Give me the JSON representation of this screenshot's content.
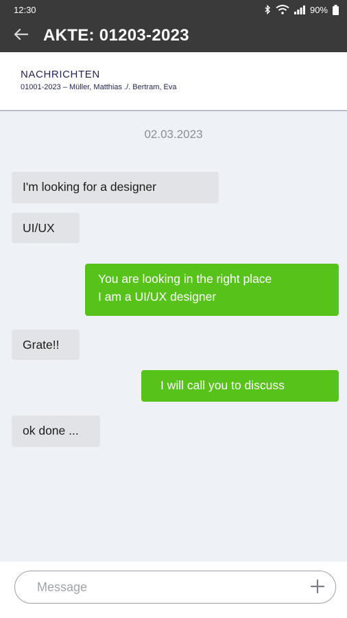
{
  "status_bar": {
    "time": "12:30",
    "battery": "90%",
    "icons": [
      "bluetooth-icon",
      "wifi-icon",
      "signal-icon",
      "battery-icon"
    ]
  },
  "app_bar": {
    "back_icon": "arrow-left-icon",
    "title": "AKTE: 01203-2023"
  },
  "header": {
    "section_title": "NACHRICHTEN",
    "case_subtitle": "01001-2023 – Müller, Matthias ./. Bertram, Eva"
  },
  "chat": {
    "date": "02.03.2023",
    "messages": [
      {
        "direction": "in",
        "lines": [
          "I'm looking for a designer"
        ]
      },
      {
        "direction": "in",
        "lines": [
          "UI/UX"
        ]
      },
      {
        "direction": "out",
        "lines": [
          "You are looking in the right place",
          "I am a UI/UX designer"
        ]
      },
      {
        "direction": "in",
        "lines": [
          "Grate!!"
        ]
      },
      {
        "direction": "out",
        "lines": [
          "I will call you to discuss"
        ]
      },
      {
        "direction": "in",
        "lines": [
          "ok done ..."
        ]
      }
    ]
  },
  "composer": {
    "placeholder": "Message",
    "value": "",
    "add_icon": "plus-icon"
  },
  "colors": {
    "app_bar": "#3a3a3a",
    "outgoing_bubble": "#57c21a",
    "incoming_bubble": "#e2e3e6",
    "chat_background": "#eef1f6",
    "header_text": "#1f2252"
  }
}
